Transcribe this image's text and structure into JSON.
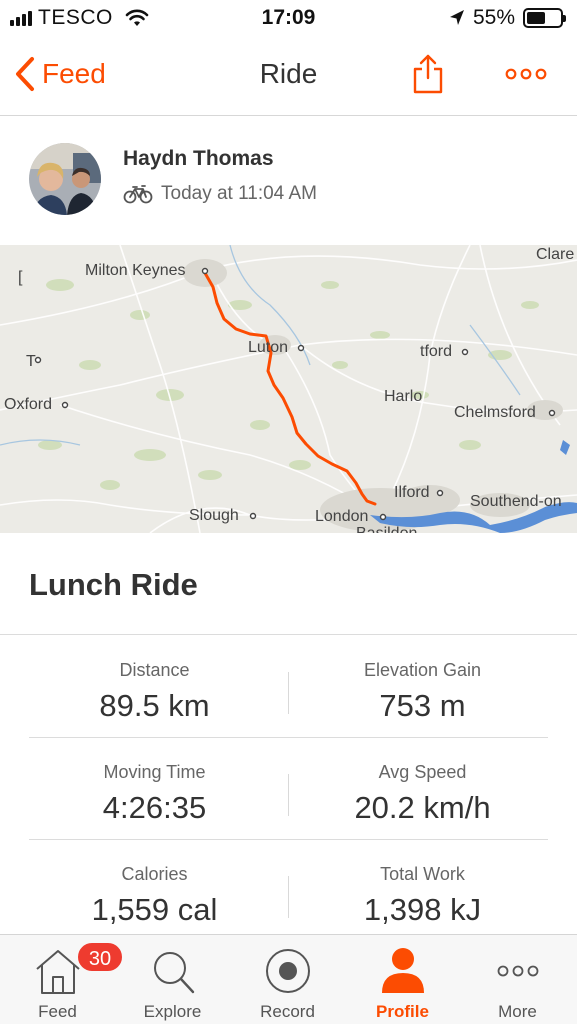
{
  "status_bar": {
    "carrier": "TESCO",
    "time": "17:09",
    "battery_percent": "55%",
    "battery_level": 0.55
  },
  "nav": {
    "back_label": "Feed",
    "title": "Ride",
    "accent_color": "#fc4c02"
  },
  "athlete": {
    "name": "Haydn Thomas",
    "timestamp": "Today at 11:04 AM",
    "activity_icon": "bike-icon"
  },
  "map": {
    "labels": {
      "milton_keynes": "Milton Keynes",
      "luton": "Luton",
      "stortford": "tford",
      "harlow": "Harlo",
      "chelmsford": "Chelmsford",
      "oxford": "Oxford",
      "clare": "Clare",
      "ilford": "Ilford",
      "southend": "Southend-on",
      "slough": "Slough",
      "london": "London",
      "basildon": "Basildon",
      "left_t": "T",
      "left_edge": "["
    },
    "route_color": "#fc4c02"
  },
  "activity": {
    "title": "Lunch Ride"
  },
  "stats": {
    "distance": {
      "label": "Distance",
      "value": "89.5 km"
    },
    "elevation": {
      "label": "Elevation Gain",
      "value": "753 m"
    },
    "moving_time": {
      "label": "Moving Time",
      "value": "4:26:35"
    },
    "avg_speed": {
      "label": "Avg Speed",
      "value": "20.2 km/h"
    },
    "calories": {
      "label": "Calories",
      "value": "1,559 cal"
    },
    "total_work": {
      "label": "Total Work",
      "value": "1,398 kJ"
    }
  },
  "tabbar": {
    "feed": {
      "label": "Feed",
      "badge": "30",
      "icon": "home-icon"
    },
    "explore": {
      "label": "Explore",
      "icon": "search-icon"
    },
    "record": {
      "label": "Record",
      "icon": "record-icon"
    },
    "profile": {
      "label": "Profile",
      "icon": "person-icon",
      "active": true
    },
    "more": {
      "label": "More",
      "icon": "more-icon"
    }
  }
}
